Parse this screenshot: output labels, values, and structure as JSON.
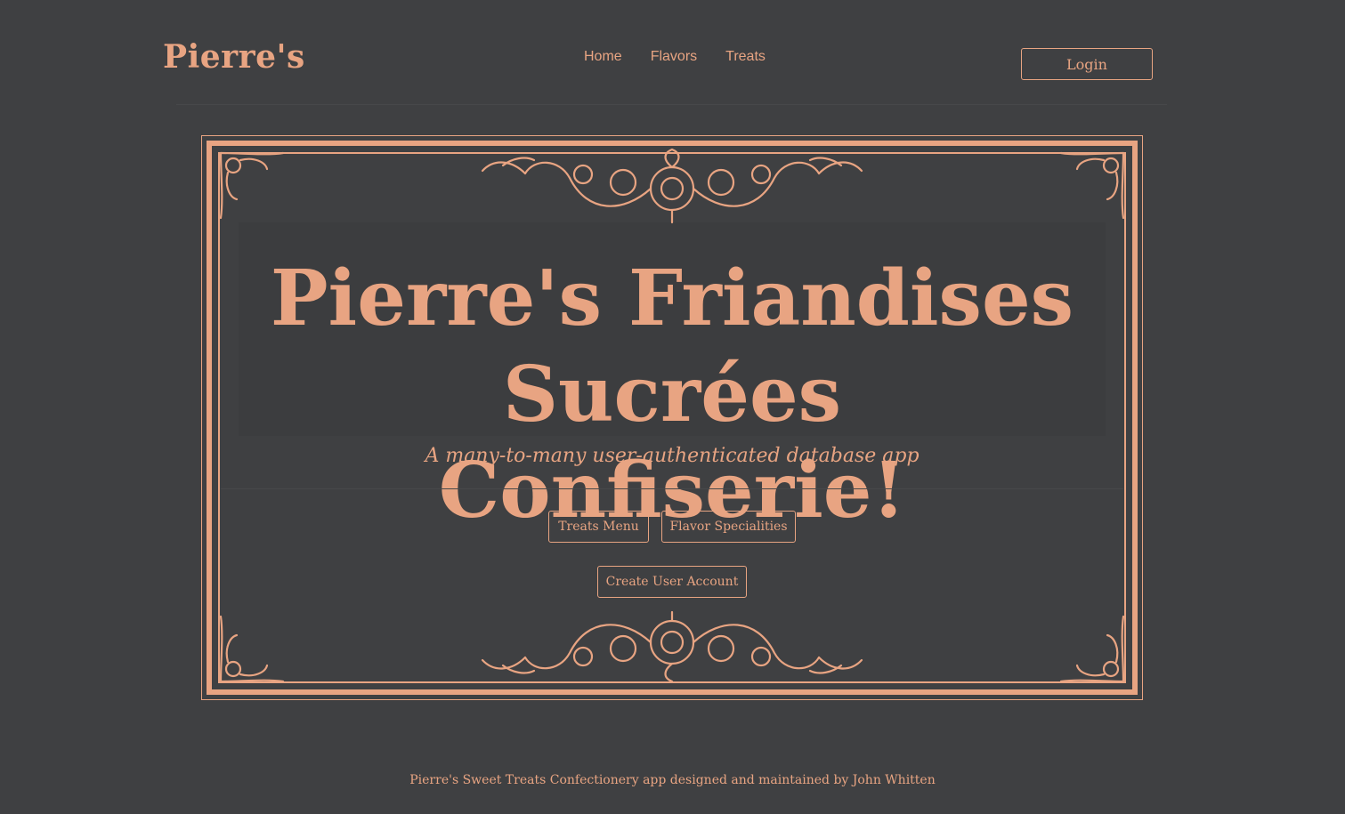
{
  "navbar": {
    "brand": "Pierre's",
    "links": [
      "Home",
      "Flavors",
      "Treats"
    ],
    "login_label": "Login"
  },
  "hero": {
    "title_line1": "Pierre's Friandises",
    "title_line2": "Sucrées Confiserie!",
    "subtitle": "A many-to-many user-authenticated database app",
    "buttons": {
      "treats_menu": "Treats Menu",
      "flavor_specialities": "Flavor Specialities",
      "create_account": "Create User Account"
    }
  },
  "footer": {
    "text": "Pierre's Sweet Treats Confectionery app designed and maintained by John Whitten"
  },
  "colors": {
    "background": "#3f4042",
    "accent": "#e8a482"
  }
}
